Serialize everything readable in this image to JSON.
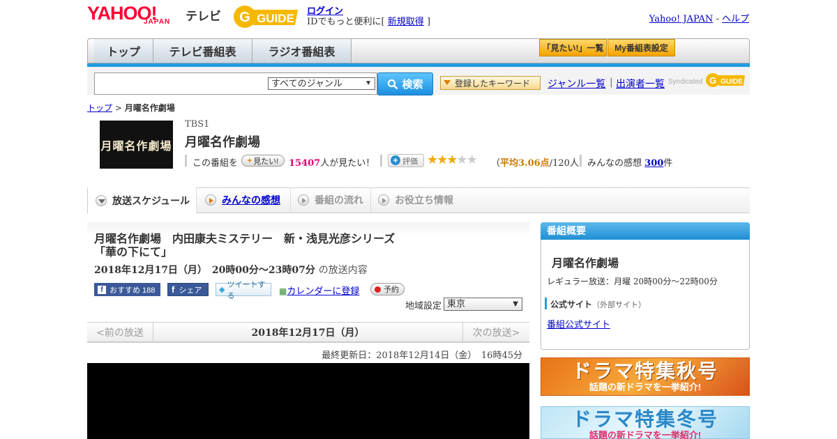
{
  "header": {
    "logo_yahoo": "YAHOO!",
    "logo_japan": "JAPAN",
    "logo_tv": "テレビ",
    "gguide_logo": "GUIDE",
    "login_link": "ログイン",
    "login_sub_prefix": "IDでもっと便利に[",
    "signup_link": "新規取得",
    "login_sub_suffix": "]",
    "yahoo_japan_link": "Yahoo! JAPAN",
    "separator": "-",
    "help_link": "ヘルプ"
  },
  "nav": {
    "tabs": [
      "トップ",
      "テレビ番組表",
      "ラジオ番組表"
    ],
    "mitai_list_button": "「見たい!」一覧",
    "my_schedule_button": "My番組表設定"
  },
  "search": {
    "input_value": "",
    "genre_selected": "すべてのジャンル",
    "search_button": "検索",
    "keyword_button": "登録したキーワード",
    "genre_list_link": "ジャンル一覧",
    "divider": "|",
    "performer_list_link": "出演者一覧",
    "syndicated_label": "Syndicated",
    "syndicated_logo": "GUIDE"
  },
  "breadcrumb": {
    "top_link": "トップ",
    "separator": ">",
    "current": "月曜名作劇場"
  },
  "program": {
    "thumbnail_text": "月曜名作劇場",
    "channel": "TBS1",
    "title": "月曜名作劇場",
    "mitai_prefix": "この番組を",
    "mitai_button": "見たい!",
    "mitai_count": "15407",
    "mitai_suffix": "人が見たい！",
    "eval_button": "評価",
    "rating_stars": 3,
    "rating_max": 5,
    "avg_prefix": "（",
    "avg_value": "平均3.06点",
    "avg_suffix": "/120人）",
    "kansou_prefix": "みんなの感想",
    "kansou_count": "300",
    "kansou_suffix": "件"
  },
  "program_tabs": [
    "放送スケジュール",
    "みんなの感想",
    "番組の流れ",
    "お役立ち情報"
  ],
  "episode": {
    "title_line1": "月曜名作劇場　内田康夫ミステリー　新・浅見光彦シリーズ",
    "title_line2": "「華の下にて」",
    "date": "2018年12月17日（月）　20時00分～23時07分",
    "date_suffix": "の放送内容",
    "fb_recommend": "おすすめ 188",
    "fb_share": "シェア",
    "tweet": "ツイートする",
    "calendar_link": "カレンダーに登録",
    "reserve_button": "予約",
    "region_label": "地域設定",
    "region_selected": "東京"
  },
  "date_nav": {
    "prev": "<前の放送",
    "current": "2018年12月17日（月）",
    "next": "次の放送>"
  },
  "updated": "最終更新日：2018年12月14日（金）　16時45分",
  "sidebar": {
    "heading": "番組概要",
    "title": "月曜名作劇場",
    "regular": "レギュラー放送：月曜 20時00分～22時00分",
    "official_label": "公式サイト",
    "official_note": "（外部サイト）",
    "official_link": "番組公式サイト"
  },
  "banners": {
    "autumn_big": "ドラマ特集秋号",
    "autumn_small": "話題の新ドラマを一挙紹介!",
    "winter_big": "ドラマ特集冬号",
    "winter_small": "話題の新ドラマを一挙紹介!"
  },
  "colors": {
    "accent_blue": "#1f9de0",
    "yahoo_red": "#ff0033",
    "highlight_pink": "#e0006e",
    "star_gold": "#f0a800"
  }
}
